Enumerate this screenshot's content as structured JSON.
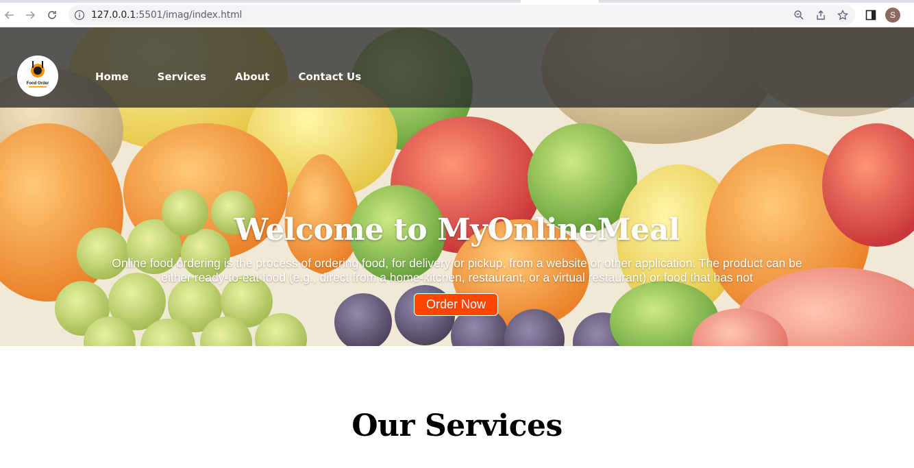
{
  "browser": {
    "url_host": "127.0.0.1",
    "url_path": ":5501/imag/index.html",
    "avatar_letter": "S"
  },
  "header": {
    "logo_text": "Food Order",
    "nav": [
      "Home",
      "Services",
      "About",
      "Contact Us"
    ]
  },
  "hero": {
    "title": "Welcome to MyOnlineMeal",
    "description": "Online food ordering is the process of ordering food, for delivery or pickup, from a website or other application. The product can be either ready-to-eat food (e.g., direct from a home-kitchen, restaurant, or a virtual restaurant) or food that has not",
    "button": "Order Now"
  },
  "services": {
    "title": "Our Services"
  },
  "colors": {
    "accent": "#ff4500",
    "header_overlay": "#2d2d2d"
  }
}
